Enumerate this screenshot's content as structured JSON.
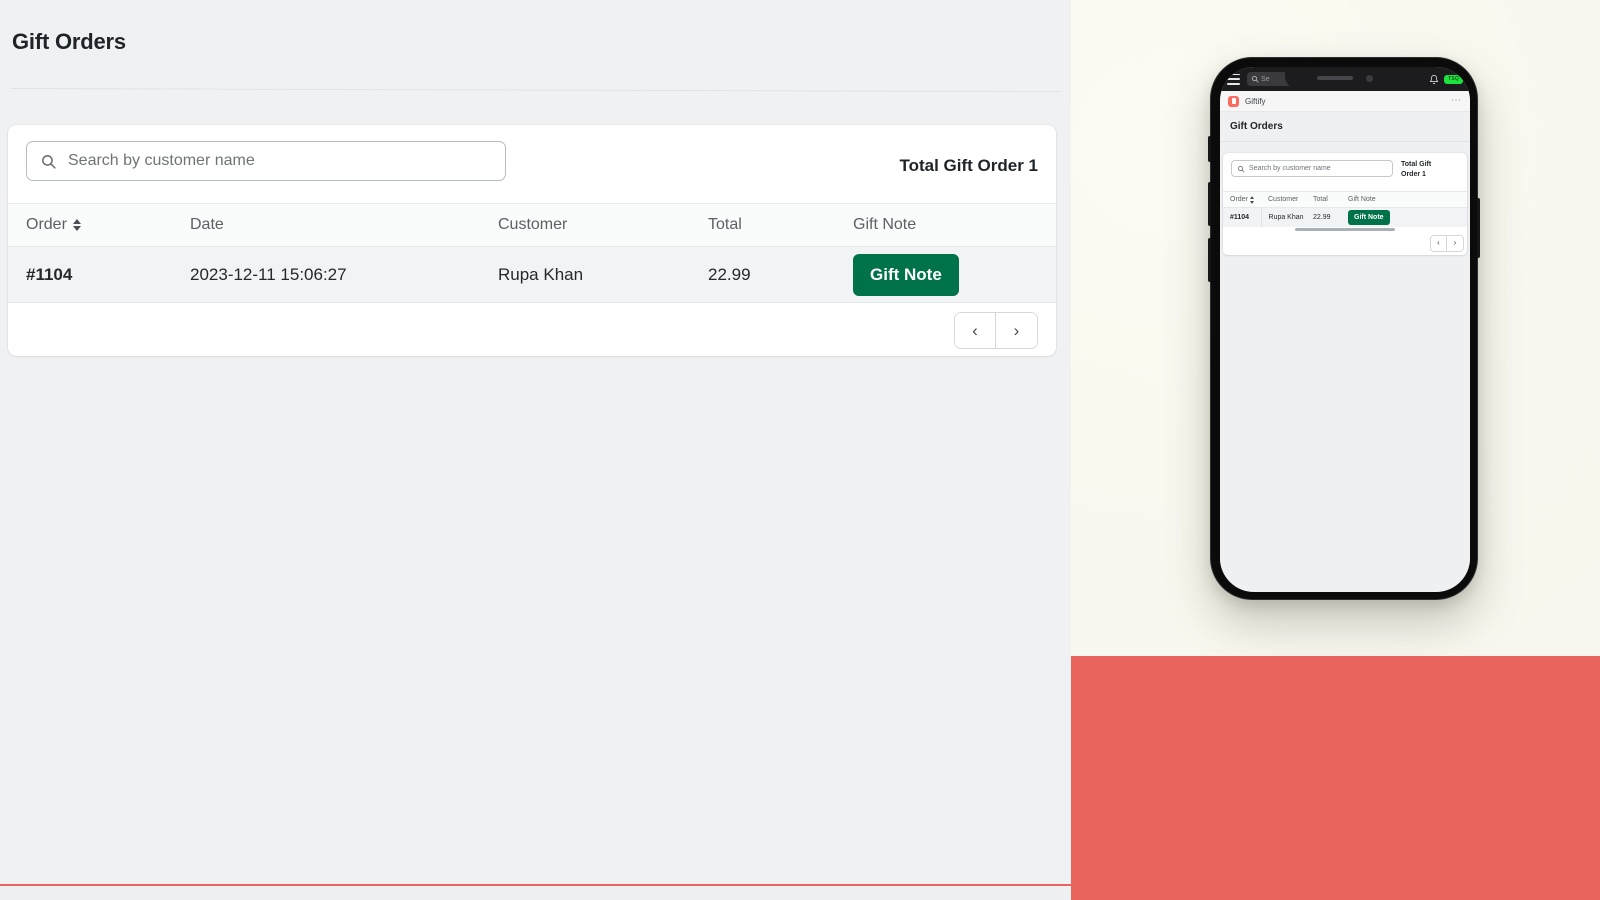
{
  "desktop": {
    "page_title": "Gift Orders",
    "search": {
      "placeholder": "Search by customer name",
      "value": "",
      "icon": "search-icon"
    },
    "total_label": "Total Gift Order 1",
    "table": {
      "columns": [
        "Order",
        "Date",
        "Customer",
        "Total",
        "Gift Note"
      ],
      "sort_column": "Order",
      "rows": [
        {
          "order": "#1104",
          "date": "2023-12-11 15:06:27",
          "customer": "Rupa Khan",
          "total": "22.99",
          "gift_note_button": "Gift Note"
        }
      ]
    },
    "pagination": {
      "prev": "‹",
      "next": "›"
    }
  },
  "mobile": {
    "status_bar": {
      "menu_icon": "hamburger-icon",
      "search_text": "Se",
      "bell_icon": "bell-icon",
      "badge": "TSQ"
    },
    "app_bar": {
      "app_name": "Giftify",
      "logo_icon": "giftify-logo-icon",
      "overflow": "⋯"
    },
    "page_title": "Gift Orders",
    "search": {
      "placeholder": "Search by customer name"
    },
    "total_label": "Total Gift Order 1",
    "table": {
      "columns": [
        "Order",
        "Customer",
        "Total",
        "Gift Note"
      ],
      "rows": [
        {
          "order": "#1104",
          "customer": "Rupa Khan",
          "total": "22.99",
          "gift_note_button": "Gift Note"
        }
      ]
    },
    "pagination": {
      "prev": "‹",
      "next": "›"
    }
  },
  "colors": {
    "accent_green": "#00724a",
    "brand_red": "#e8645d",
    "logo_red": "#fa6b62",
    "badge_green": "#1ee33f",
    "page_bg": "#f0f1f3"
  }
}
